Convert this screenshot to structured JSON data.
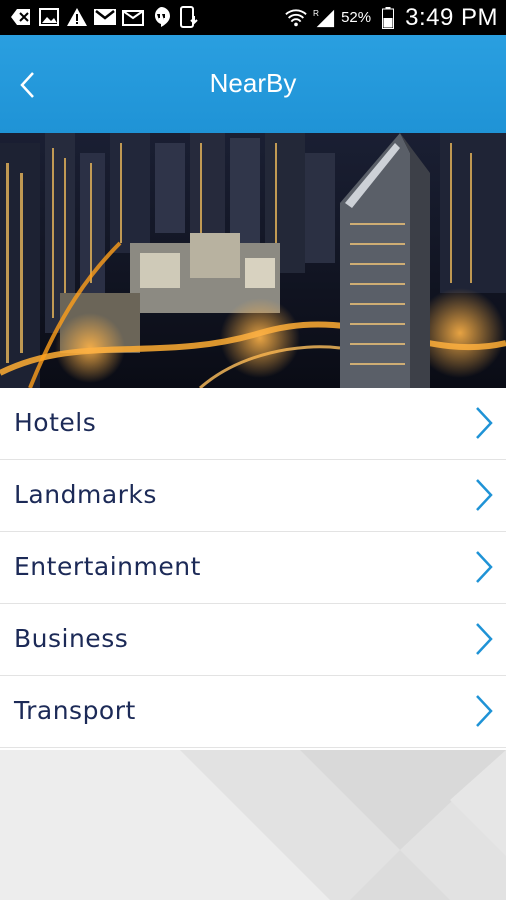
{
  "status_bar": {
    "battery": "52%",
    "time": "3:49 PM",
    "icons": [
      "back-icon",
      "image-icon",
      "warning-icon",
      "gmail-icon",
      "mail-icon",
      "hangouts-icon",
      "phone-download-icon",
      "wifi-icon",
      "signal-icon",
      "battery-icon"
    ]
  },
  "header": {
    "title": "NearBy",
    "back_icon": "chevron-left-icon"
  },
  "colors": {
    "accent": "#1f93d6",
    "text": "#1c2a57"
  },
  "menu": {
    "items": [
      {
        "label": "Hotels"
      },
      {
        "label": "Landmarks"
      },
      {
        "label": "Entertainment"
      },
      {
        "label": "Business"
      },
      {
        "label": "Transport"
      }
    ]
  }
}
